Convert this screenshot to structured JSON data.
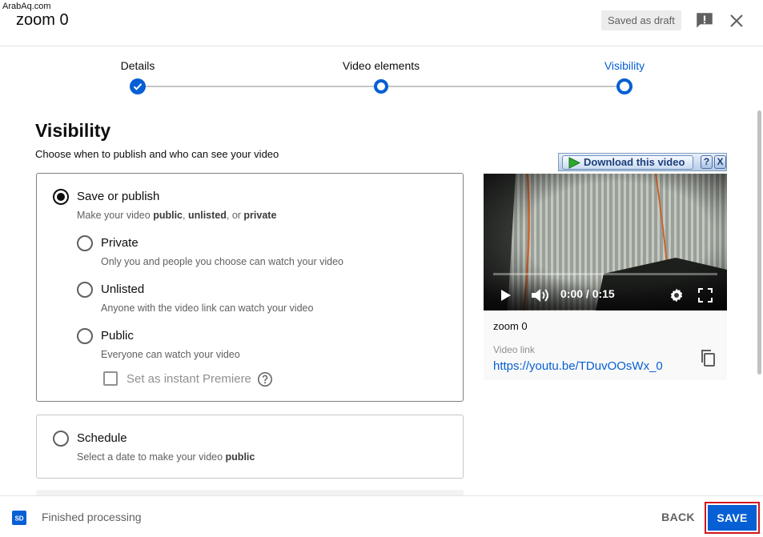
{
  "watermark": "ArabAq.com",
  "header": {
    "title": "zoom 0",
    "draft_status": "Saved as draft"
  },
  "stepper": {
    "steps": [
      {
        "label": "Details",
        "state": "completed"
      },
      {
        "label": "Video elements",
        "state": "current"
      },
      {
        "label": "Visibility",
        "state": "current-active"
      }
    ]
  },
  "visibility": {
    "title": "Visibility",
    "subtitle": "Choose when to publish and who can see your video",
    "save_or_publish": {
      "label": "Save or publish",
      "desc_prefix": "Make your video ",
      "desc_b1": "public",
      "desc_sep1": ", ",
      "desc_b2": "unlisted",
      "desc_sep2": ", or ",
      "desc_b3": "private",
      "selected": true
    },
    "options": [
      {
        "label": "Private",
        "desc": "Only you and people you choose can watch your video",
        "selected": false
      },
      {
        "label": "Unlisted",
        "desc": "Anyone with the video link can watch your video",
        "selected": false
      },
      {
        "label": "Public",
        "desc": "Everyone can watch your video",
        "selected": false
      }
    ],
    "premiere": {
      "label": "Set as instant Premiere",
      "checked": false
    },
    "schedule": {
      "label": "Schedule",
      "desc_prefix": "Select a date to make your video ",
      "desc_bold": "public",
      "selected": false
    }
  },
  "download_bar": {
    "label": "Download this video",
    "help": "?",
    "close": "X"
  },
  "preview": {
    "time": "0:00 / 0:15",
    "progress": 0,
    "title": "zoom 0",
    "link_label": "Video link",
    "link_url": "https://youtu.be/TDuvOOsWx_0"
  },
  "footer": {
    "sd_badge": "SD",
    "status": "Finished processing",
    "back_label": "BACK",
    "save_label": "SAVE"
  },
  "colors": {
    "accent": "#065fd4",
    "highlight_border": "#d1151b",
    "secondary_text": "#606060"
  }
}
